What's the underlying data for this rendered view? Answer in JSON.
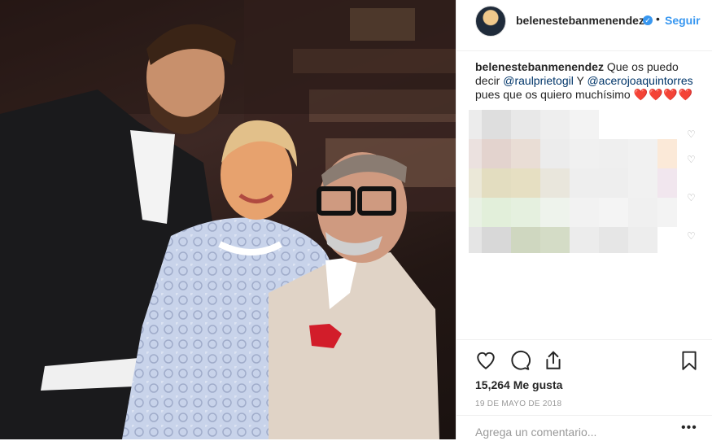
{
  "post": {
    "username": "belenestebanmenendez",
    "follow_label": "Seguir",
    "separator": "•",
    "caption": {
      "username": "belenestebanmenendez",
      "text_1": "Que os puedo decir",
      "mention_1": "@raulprietogil",
      "text_2": "Y",
      "mention_2": "@acerojoaquintorres",
      "text_3": "pues que os quiero muchísimo",
      "emoji": "❤️❤️❤️❤️"
    },
    "likes": "15,264 Me gusta",
    "date": "19 DE MAYO DE 2018",
    "comment_placeholder": "Agrega un comentario...",
    "more_label": "•••"
  },
  "icons": {
    "verified": "verified-badge-icon",
    "like": "heart-icon",
    "comment": "comment-bubble-icon",
    "share": "share-icon",
    "save": "bookmark-icon"
  },
  "colors": {
    "accent": "#3897f0",
    "heart": "#e0245e",
    "border": "#efefef",
    "muted": "#999999"
  }
}
